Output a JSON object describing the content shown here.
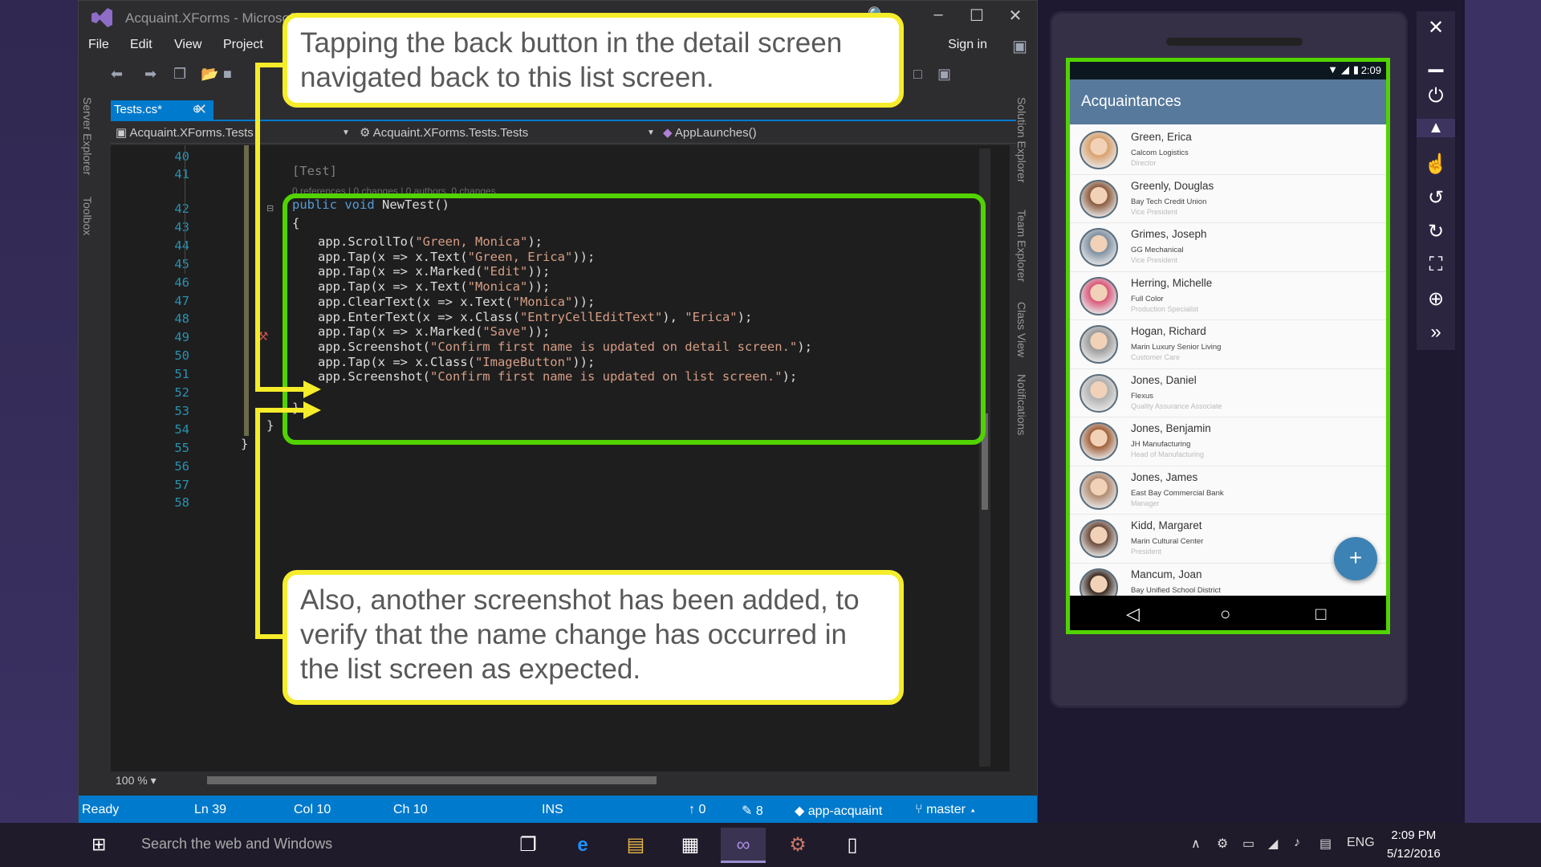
{
  "vs": {
    "title": "Acquaint.XForms - Microsof",
    "menu": [
      "File",
      "Edit",
      "View",
      "Project"
    ],
    "sign_in": "Sign in",
    "left_rail": [
      "Server Explorer",
      "Toolbox"
    ],
    "right_rail": [
      "Solution Explorer",
      "Team Explorer",
      "Class View",
      "Notifications"
    ],
    "tab_label": "Tests.cs*",
    "nav": {
      "project": "Acquaint.XForms.Tests",
      "class": "Acquaint.XForms.Tests.Tests",
      "member": "AppLaunches()"
    },
    "code": {
      "line_numbers": [
        "40",
        "41",
        "42",
        "43",
        "44",
        "45",
        "46",
        "47",
        "48",
        "49",
        "50",
        "51",
        "52",
        "53",
        "54",
        "55",
        "56",
        "57",
        "58"
      ],
      "attribute": "[Test]",
      "codelens": "0 references | 0 changes | 0 authors, 0 changes",
      "signature_kw": "public void",
      "signature_name": " NewTest()",
      "open_brace": "{",
      "close_brace": "}",
      "close_class": "}",
      "close_ns": "}",
      "lines": [
        {
          "pre": "app.ScrollTo(",
          "s": "\"Green, Monica\"",
          "post": ");"
        },
        {
          "pre": "app.Tap(x => x.Text(",
          "s": "\"Green, Erica\"",
          "post": "));"
        },
        {
          "pre": "app.Tap(x => x.Marked(",
          "s": "\"Edit\"",
          "post": "));"
        },
        {
          "pre": "app.Tap(x => x.Text(",
          "s": "\"Monica\"",
          "post": "));"
        },
        {
          "pre": "app.ClearText(x => x.Text(",
          "s": "\"Monica\"",
          "post": "));"
        },
        {
          "pre": "app.EnterText(x => x.Class(",
          "s": "\"EntryCellEditText\"",
          "mid": "), ",
          "s2": "\"Erica\"",
          "post": ");"
        },
        {
          "pre": "app.Tap(x => x.Marked(",
          "s": "\"Save\"",
          "post": "));"
        },
        {
          "pre": "app.Screenshot(",
          "s": "\"Confirm first name is updated on detail screen.\"",
          "post": ");"
        },
        {
          "pre": "app.Tap(x => x.Class(",
          "s": "\"ImageButton\"",
          "post": "));"
        },
        {
          "pre": "app.Screenshot(",
          "s": "\"Confirm first name is updated on list screen.\"",
          "post": ");"
        }
      ]
    },
    "zoom": "100 %",
    "status": {
      "ready": "Ready",
      "ln": "Ln 39",
      "col": "Col 10",
      "ch": "Ch 10",
      "ins": "INS",
      "up_count": "0",
      "pen_count": "8",
      "repo": "app-acquaint",
      "branch": "master"
    }
  },
  "callouts": {
    "top": "Tapping the back button in the detail screen navigated back to this list screen.",
    "bottom": "Also, another screenshot has been added, to verify that the name change has occurred in the list screen as expected."
  },
  "phone": {
    "time": "2:09",
    "app_title": "Acquaintances",
    "fab": "+",
    "contacts": [
      {
        "name": "Green, Erica",
        "company": "Calcom Logistics",
        "title": "Director",
        "color": "#d9a06b"
      },
      {
        "name": "Greenly, Douglas",
        "company": "Bay Tech Credit Union",
        "title": "Vice President",
        "color": "#8a5a3c"
      },
      {
        "name": "Grimes, Joseph",
        "company": "GG Mechanical",
        "title": "Vice President",
        "color": "#7d8fa0"
      },
      {
        "name": "Herring, Michelle",
        "company": "Full Color",
        "title": "Production Specialist",
        "color": "#d9577a"
      },
      {
        "name": "Hogan, Richard",
        "company": "Marin Luxury Senior Living",
        "title": "Customer Care",
        "color": "#9a9a9a"
      },
      {
        "name": "Jones, Daniel",
        "company": "Flexus",
        "title": "Quality Assurance Associate",
        "color": "#b0b0b0"
      },
      {
        "name": "Jones, Benjamin",
        "company": "JH Manufacturing",
        "title": "Head of Manufacturing",
        "color": "#a0603a"
      },
      {
        "name": "Jones, James",
        "company": "East Bay Commercial Bank",
        "title": "Manager",
        "color": "#b08a70"
      },
      {
        "name": "Kidd, Margaret",
        "company": "Marin Cultural Center",
        "title": "President",
        "color": "#6a4a3a"
      },
      {
        "name": "Mancum, Joan",
        "company": "Bay Unified School District",
        "title": "",
        "color": "#3a2a22"
      }
    ]
  },
  "taskbar": {
    "search": "Search the web and Windows",
    "lang": "ENG",
    "time": "2:09 PM",
    "date": "5/12/2016"
  }
}
